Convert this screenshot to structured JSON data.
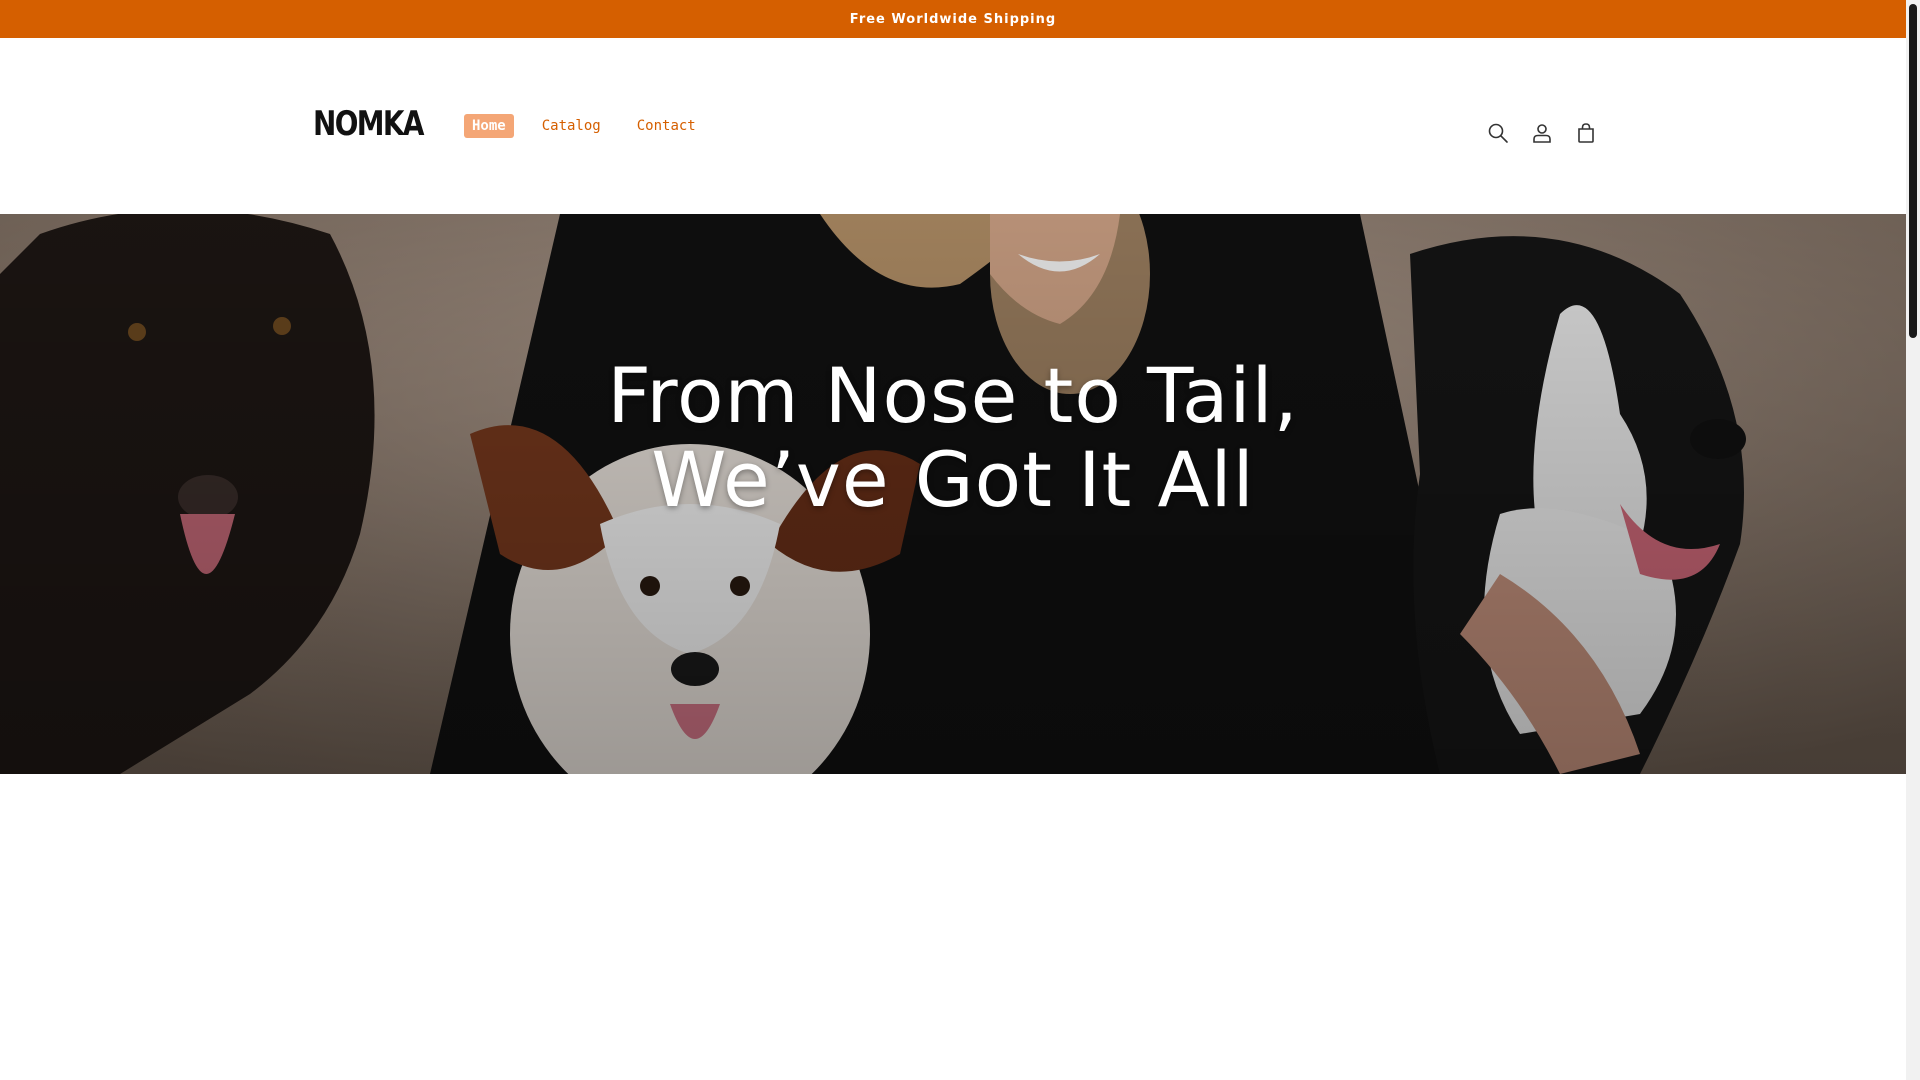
{
  "announcement": {
    "text": "Free Worldwide Shipping"
  },
  "header": {
    "logo": "NOMKA",
    "nav": [
      {
        "label": "Home",
        "active": true
      },
      {
        "label": "Catalog",
        "active": false
      },
      {
        "label": "Contact",
        "active": false
      }
    ],
    "icons": [
      "search-icon",
      "account-icon",
      "cart-icon"
    ]
  },
  "hero": {
    "heading_line1": "From Nose to Tail,",
    "heading_line2": "We’ve Got It All"
  },
  "colors": {
    "accent": "#d55f00",
    "nav_active_bg": "#f4a676"
  }
}
